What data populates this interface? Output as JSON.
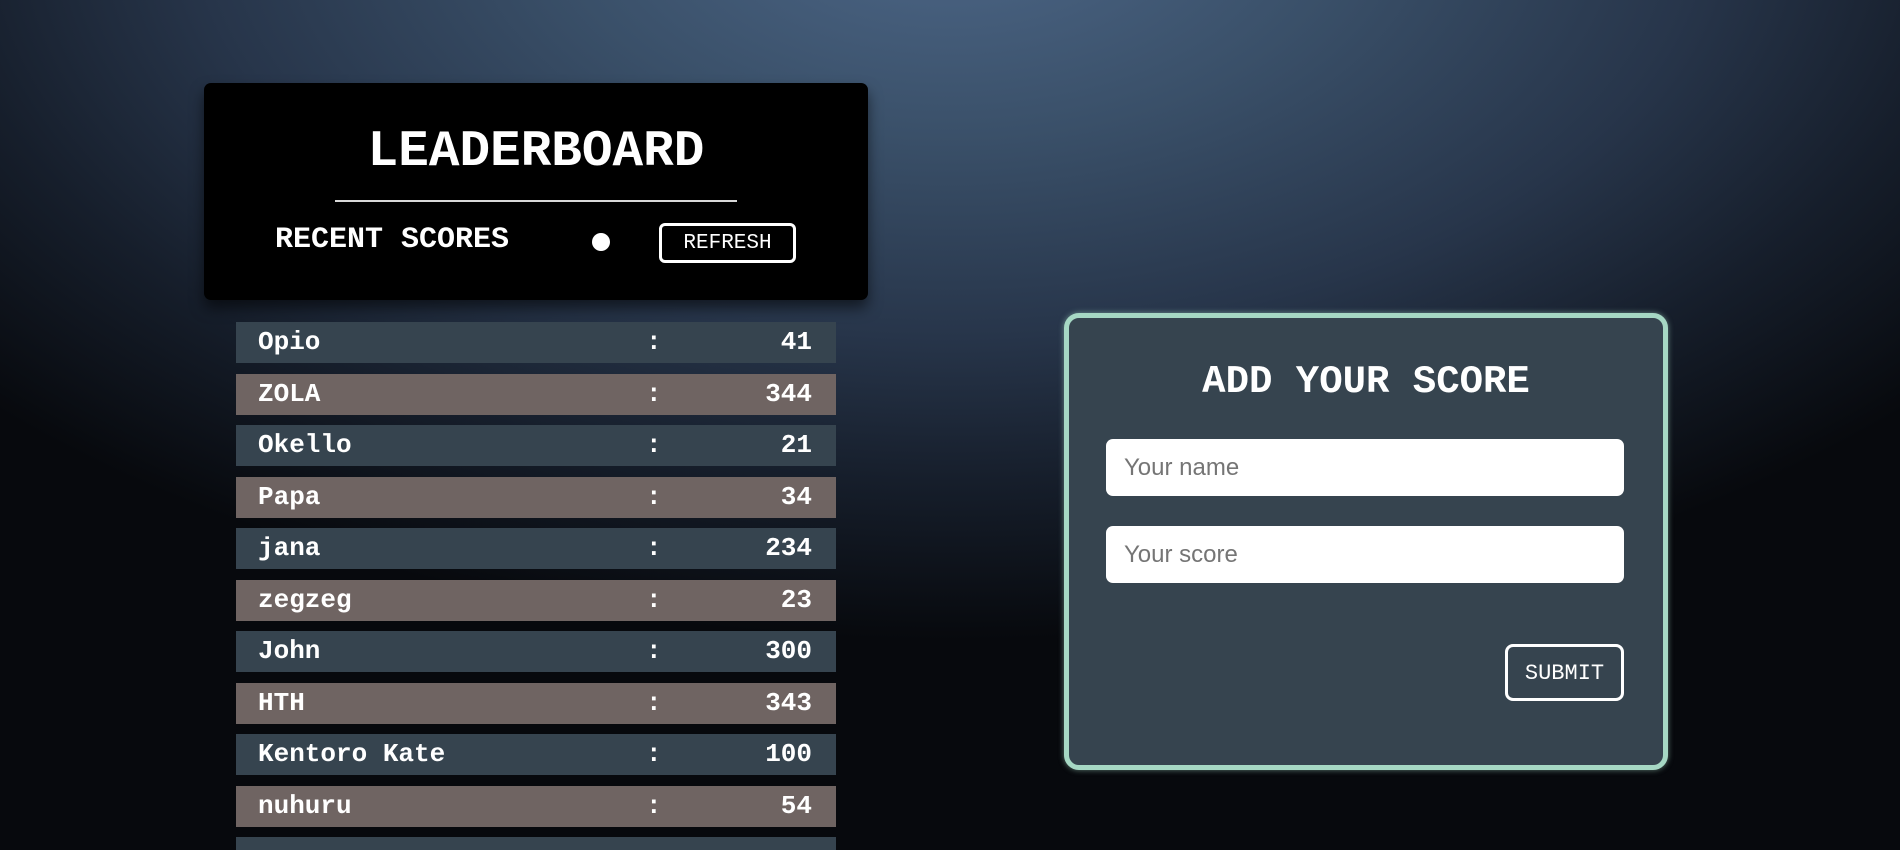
{
  "leaderboard": {
    "title": "LEADERBOARD",
    "subtitle": "RECENT SCORES",
    "refresh_label": "REFRESH"
  },
  "scores": [
    {
      "name": "Opio",
      "sep": ":",
      "score": "41"
    },
    {
      "name": "ZOLA",
      "sep": ":",
      "score": "344"
    },
    {
      "name": "Okello",
      "sep": ":",
      "score": "21"
    },
    {
      "name": "Papa",
      "sep": ":",
      "score": "34"
    },
    {
      "name": "jana",
      "sep": ":",
      "score": "234"
    },
    {
      "name": "zegzeg",
      "sep": ":",
      "score": "23"
    },
    {
      "name": "John",
      "sep": ":",
      "score": "300"
    },
    {
      "name": "HTH",
      "sep": ":",
      "score": "343"
    },
    {
      "name": "Kentoro Kate",
      "sep": ":",
      "score": "100"
    },
    {
      "name": "nuhuru",
      "sep": ":",
      "score": "54"
    },
    {
      "name": "",
      "sep": ":",
      "score": ""
    }
  ],
  "add_score": {
    "title": "ADD YOUR SCORE",
    "name_placeholder": "Your name",
    "name_value": "",
    "score_placeholder": "Your score",
    "score_value": "",
    "submit_label": "SUBMIT"
  },
  "colors": {
    "row_odd": "#36444f",
    "row_even": "#6f6462",
    "card_border": "#a6d8c4",
    "card_bg": "#36444f",
    "header_bg": "#000000"
  }
}
